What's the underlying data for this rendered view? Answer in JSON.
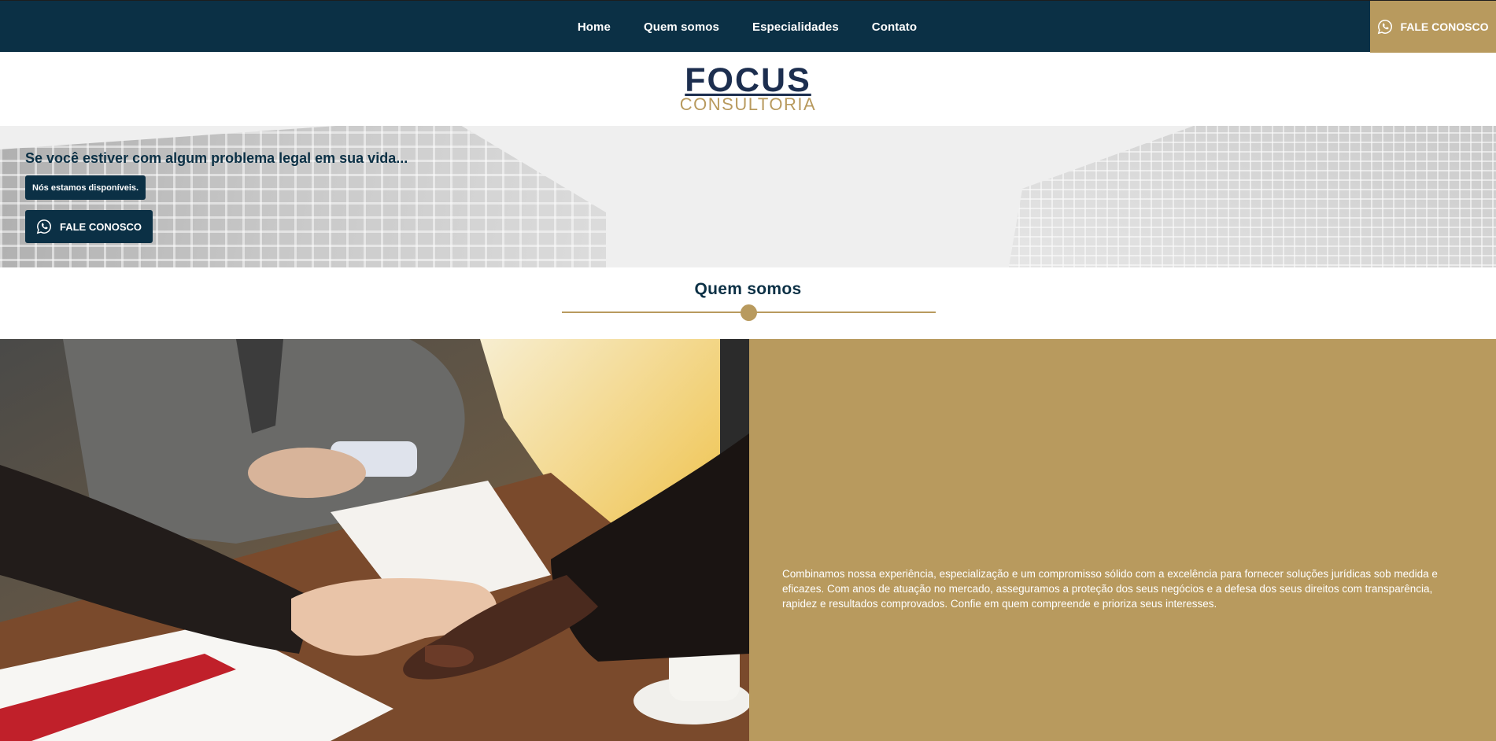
{
  "nav": {
    "links": [
      "Home",
      "Quem somos",
      "Especialidades",
      "Contato"
    ],
    "cta_label": "FALE CONOSCO",
    "cta_icon": "whatsapp-icon"
  },
  "logo": {
    "main": "FOCUS",
    "sub": "CONSULTORIA"
  },
  "hero": {
    "title": "Se você estiver com algum problema legal em sua vida...",
    "badge": "Nós estamos disponíveis.",
    "button_label": "FALE CONOSCO",
    "button_icon": "whatsapp-icon"
  },
  "about": {
    "title": "Quem somos",
    "text": "Combinamos nossa experiência, especialização e um compromisso sólido com a excelência para fornecer soluções jurídicas sob medida e eficazes. Com anos de atuação no mercado, asseguramos a proteção dos seus negócios e a defesa dos seus direitos com transparência, rapidez e resultados comprovados. Confie em quem compreende e prioriza seus interesses."
  },
  "colors": {
    "navy": "#0b3045",
    "gold": "#b89a5e",
    "logo_blue": "#1c2e4f"
  }
}
